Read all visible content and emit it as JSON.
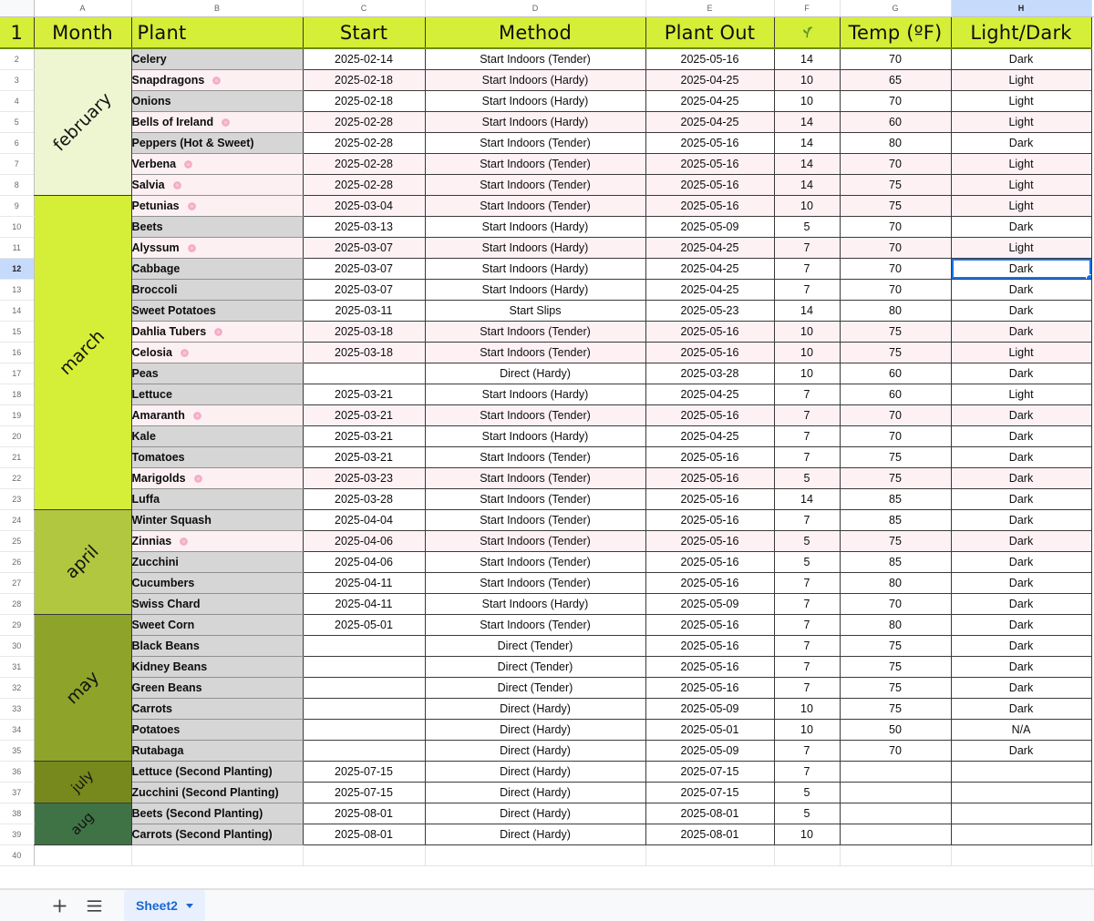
{
  "app": {
    "name": "Google Sheets grid"
  },
  "grid": {
    "column_letters": [
      "A",
      "B",
      "C",
      "D",
      "E",
      "F",
      "G",
      "H"
    ],
    "selected_column": "H",
    "selected_row": 12,
    "selected_cell": "H12",
    "first_row_number": 1,
    "last_row_number": 40
  },
  "header": {
    "month": "Month",
    "plant": "Plant",
    "start": "Start",
    "method": "Method",
    "plant_out": "Plant Out",
    "depth_icon": "seedling-icon",
    "temp": "Temp (ºF)",
    "light_dark": "Light/Dark"
  },
  "months": [
    {
      "name": "february",
      "rows": 7,
      "color": "#eef5d1"
    },
    {
      "name": "march",
      "rows": 15,
      "color": "#d5ee37"
    },
    {
      "name": "april",
      "rows": 5,
      "color": "#b0c73f"
    },
    {
      "name": "may",
      "rows": 7,
      "color": "#8ea32a"
    },
    {
      "name": "july",
      "rows": 2,
      "color": "#77881c"
    },
    {
      "name": "aug",
      "rows": 2,
      "color": "#3f7346"
    }
  ],
  "rows": [
    {
      "n": 2,
      "plant": "Celery",
      "flower": false,
      "start": "2025-02-14",
      "method": "Start Indoors (Tender)",
      "plant_out": "2025-05-16",
      "depth": "14",
      "temp": "70",
      "light": "Dark"
    },
    {
      "n": 3,
      "plant": "Snapdragons",
      "flower": true,
      "start": "2025-02-18",
      "method": "Start Indoors (Hardy)",
      "plant_out": "2025-04-25",
      "depth": "10",
      "temp": "65",
      "light": "Light"
    },
    {
      "n": 4,
      "plant": "Onions",
      "flower": false,
      "start": "2025-02-18",
      "method": "Start Indoors (Hardy)",
      "plant_out": "2025-04-25",
      "depth": "10",
      "temp": "70",
      "light": "Light"
    },
    {
      "n": 5,
      "plant": "Bells of Ireland",
      "flower": true,
      "start": "2025-02-28",
      "method": "Start Indoors (Hardy)",
      "plant_out": "2025-04-25",
      "depth": "14",
      "temp": "60",
      "light": "Light"
    },
    {
      "n": 6,
      "plant": "Peppers (Hot & Sweet)",
      "flower": false,
      "start": "2025-02-28",
      "method": "Start Indoors (Tender)",
      "plant_out": "2025-05-16",
      "depth": "14",
      "temp": "80",
      "light": "Dark"
    },
    {
      "n": 7,
      "plant": "Verbena",
      "flower": true,
      "start": "2025-02-28",
      "method": "Start Indoors (Tender)",
      "plant_out": "2025-05-16",
      "depth": "14",
      "temp": "70",
      "light": "Light"
    },
    {
      "n": 8,
      "plant": "Salvia",
      "flower": true,
      "start": "2025-02-28",
      "method": "Start Indoors (Tender)",
      "plant_out": "2025-05-16",
      "depth": "14",
      "temp": "75",
      "light": "Light"
    },
    {
      "n": 9,
      "plant": "Petunias",
      "flower": true,
      "start": "2025-03-04",
      "method": "Start Indoors (Tender)",
      "plant_out": "2025-05-16",
      "depth": "10",
      "temp": "75",
      "light": "Light"
    },
    {
      "n": 10,
      "plant": "Beets",
      "flower": false,
      "start": "2025-03-13",
      "method": "Start Indoors (Hardy)",
      "plant_out": "2025-05-09",
      "depth": "5",
      "temp": "70",
      "light": "Dark"
    },
    {
      "n": 11,
      "plant": "Alyssum",
      "flower": true,
      "start": "2025-03-07",
      "method": "Start Indoors (Hardy)",
      "plant_out": "2025-04-25",
      "depth": "7",
      "temp": "70",
      "light": "Light"
    },
    {
      "n": 12,
      "plant": "Cabbage",
      "flower": false,
      "start": "2025-03-07",
      "method": "Start Indoors (Hardy)",
      "plant_out": "2025-04-25",
      "depth": "7",
      "temp": "70",
      "light": "Dark"
    },
    {
      "n": 13,
      "plant": "Broccoli",
      "flower": false,
      "start": "2025-03-07",
      "method": "Start Indoors (Hardy)",
      "plant_out": "2025-04-25",
      "depth": "7",
      "temp": "70",
      "light": "Dark"
    },
    {
      "n": 14,
      "plant": "Sweet Potatoes",
      "flower": false,
      "start": "2025-03-11",
      "method": "Start Slips",
      "plant_out": "2025-05-23",
      "depth": "14",
      "temp": "80",
      "light": "Dark"
    },
    {
      "n": 15,
      "plant": "Dahlia Tubers",
      "flower": true,
      "start": "2025-03-18",
      "method": "Start Indoors (Tender)",
      "plant_out": "2025-05-16",
      "depth": "10",
      "temp": "75",
      "light": "Dark"
    },
    {
      "n": 16,
      "plant": "Celosia",
      "flower": true,
      "start": "2025-03-18",
      "method": "Start Indoors (Tender)",
      "plant_out": "2025-05-16",
      "depth": "10",
      "temp": "75",
      "light": "Light"
    },
    {
      "n": 17,
      "plant": "Peas",
      "flower": false,
      "start": "",
      "method": "Direct (Hardy)",
      "plant_out": "2025-03-28",
      "depth": "10",
      "temp": "60",
      "light": "Dark"
    },
    {
      "n": 18,
      "plant": "Lettuce",
      "flower": false,
      "start": "2025-03-21",
      "method": "Start Indoors (Hardy)",
      "plant_out": "2025-04-25",
      "depth": "7",
      "temp": "60",
      "light": "Light"
    },
    {
      "n": 19,
      "plant": "Amaranth",
      "flower": true,
      "start": "2025-03-21",
      "method": "Start Indoors (Tender)",
      "plant_out": "2025-05-16",
      "depth": "7",
      "temp": "70",
      "light": "Dark"
    },
    {
      "n": 20,
      "plant": "Kale",
      "flower": false,
      "start": "2025-03-21",
      "method": "Start Indoors (Hardy)",
      "plant_out": "2025-04-25",
      "depth": "7",
      "temp": "70",
      "light": "Dark"
    },
    {
      "n": 21,
      "plant": "Tomatoes",
      "flower": false,
      "start": "2025-03-21",
      "method": "Start Indoors (Tender)",
      "plant_out": "2025-05-16",
      "depth": "7",
      "temp": "75",
      "light": "Dark"
    },
    {
      "n": 22,
      "plant": "Marigolds",
      "flower": true,
      "start": "2025-03-23",
      "method": "Start Indoors (Tender)",
      "plant_out": "2025-05-16",
      "depth": "5",
      "temp": "75",
      "light": "Dark"
    },
    {
      "n": 23,
      "plant": "Luffa",
      "flower": false,
      "start": "2025-03-28",
      "method": "Start Indoors (Tender)",
      "plant_out": "2025-05-16",
      "depth": "14",
      "temp": "85",
      "light": "Dark"
    },
    {
      "n": 24,
      "plant": "Winter Squash",
      "flower": false,
      "start": "2025-04-04",
      "method": "Start Indoors (Tender)",
      "plant_out": "2025-05-16",
      "depth": "7",
      "temp": "85",
      "light": "Dark"
    },
    {
      "n": 25,
      "plant": "Zinnias",
      "flower": true,
      "start": "2025-04-06",
      "method": "Start Indoors (Tender)",
      "plant_out": "2025-05-16",
      "depth": "5",
      "temp": "75",
      "light": "Dark"
    },
    {
      "n": 26,
      "plant": "Zucchini",
      "flower": false,
      "start": "2025-04-06",
      "method": "Start Indoors (Tender)",
      "plant_out": "2025-05-16",
      "depth": "5",
      "temp": "85",
      "light": "Dark"
    },
    {
      "n": 27,
      "plant": "Cucumbers",
      "flower": false,
      "start": "2025-04-11",
      "method": "Start Indoors (Tender)",
      "plant_out": "2025-05-16",
      "depth": "7",
      "temp": "80",
      "light": "Dark"
    },
    {
      "n": 28,
      "plant": "Swiss Chard",
      "flower": false,
      "start": "2025-04-11",
      "method": "Start Indoors (Hardy)",
      "plant_out": "2025-05-09",
      "depth": "7",
      "temp": "70",
      "light": "Dark"
    },
    {
      "n": 29,
      "plant": "Sweet Corn",
      "flower": false,
      "start": "2025-05-01",
      "method": "Start Indoors (Tender)",
      "plant_out": "2025-05-16",
      "depth": "7",
      "temp": "80",
      "light": "Dark"
    },
    {
      "n": 30,
      "plant": "Black Beans",
      "flower": false,
      "start": "",
      "method": "Direct (Tender)",
      "plant_out": "2025-05-16",
      "depth": "7",
      "temp": "75",
      "light": "Dark"
    },
    {
      "n": 31,
      "plant": "Kidney Beans",
      "flower": false,
      "start": "",
      "method": "Direct (Tender)",
      "plant_out": "2025-05-16",
      "depth": "7",
      "temp": "75",
      "light": "Dark"
    },
    {
      "n": 32,
      "plant": "Green Beans",
      "flower": false,
      "start": "",
      "method": "Direct (Tender)",
      "plant_out": "2025-05-16",
      "depth": "7",
      "temp": "75",
      "light": "Dark"
    },
    {
      "n": 33,
      "plant": "Carrots",
      "flower": false,
      "start": "",
      "method": "Direct (Hardy)",
      "plant_out": "2025-05-09",
      "depth": "10",
      "temp": "75",
      "light": "Dark"
    },
    {
      "n": 34,
      "plant": "Potatoes",
      "flower": false,
      "start": "",
      "method": "Direct (Hardy)",
      "plant_out": "2025-05-01",
      "depth": "10",
      "temp": "50",
      "light": "N/A"
    },
    {
      "n": 35,
      "plant": "Rutabaga",
      "flower": false,
      "start": "",
      "method": "Direct (Hardy)",
      "plant_out": "2025-05-09",
      "depth": "7",
      "temp": "70",
      "light": "Dark"
    },
    {
      "n": 36,
      "plant": "Lettuce (Second Planting)",
      "flower": false,
      "start": "2025-07-15",
      "method": "Direct (Hardy)",
      "plant_out": "2025-07-15",
      "depth": "7",
      "temp": "",
      "light": ""
    },
    {
      "n": 37,
      "plant": "Zucchini (Second Planting)",
      "flower": false,
      "start": "2025-07-15",
      "method": "Direct (Hardy)",
      "plant_out": "2025-07-15",
      "depth": "5",
      "temp": "",
      "light": ""
    },
    {
      "n": 38,
      "plant": "Beets (Second Planting)",
      "flower": false,
      "start": "2025-08-01",
      "method": "Direct (Hardy)",
      "plant_out": "2025-08-01",
      "depth": "5",
      "temp": "",
      "light": ""
    },
    {
      "n": 39,
      "plant": "Carrots (Second Planting)",
      "flower": false,
      "start": "2025-08-01",
      "method": "Direct (Hardy)",
      "plant_out": "2025-08-01",
      "depth": "10",
      "temp": "",
      "light": ""
    }
  ],
  "sheet_bar": {
    "add_sheet_icon": "plus-icon",
    "all_sheets_icon": "hamburger-icon",
    "active_tab": "Sheet2",
    "tab_caret_icon": "chevron-down-icon"
  },
  "colors": {
    "header_green": "#d5ee37",
    "selection_blue": "#1a73e8",
    "header_select_blue": "#c6dafc",
    "tab_blue": "#1967d2",
    "tab_bg": "#e8f0fe",
    "row_gray": "#d6d6d6",
    "row_pink": "#fdf0f3"
  }
}
